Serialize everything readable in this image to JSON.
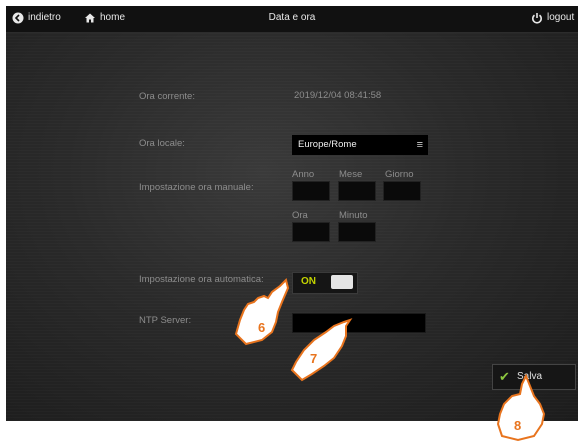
{
  "topbar": {
    "back_label": "indietro",
    "home_label": "home",
    "title": "Data e ora",
    "logout_label": "logout"
  },
  "form": {
    "current_time_label": "Ora corrente:",
    "current_time_value": "2019/12/04 08:41:58",
    "local_time_label": "Ora locale:",
    "timezone_value": "Europe/Rome",
    "manual_label": "Impostazione ora manuale:",
    "year_label": "Anno",
    "month_label": "Mese",
    "day_label": "Giorno",
    "hour_label": "Ora",
    "minute_label": "Minuto",
    "auto_label": "Impostazione ora automatica:",
    "auto_state": "ON",
    "ntp_label": "NTP Server:"
  },
  "save_label": "Salva",
  "annotations": {
    "callout_6": "6",
    "callout_7": "7",
    "callout_8": "8"
  },
  "colors": {
    "toggle_on": "#c4d400",
    "check": "#8cc63f",
    "callout": "#e8741e"
  }
}
